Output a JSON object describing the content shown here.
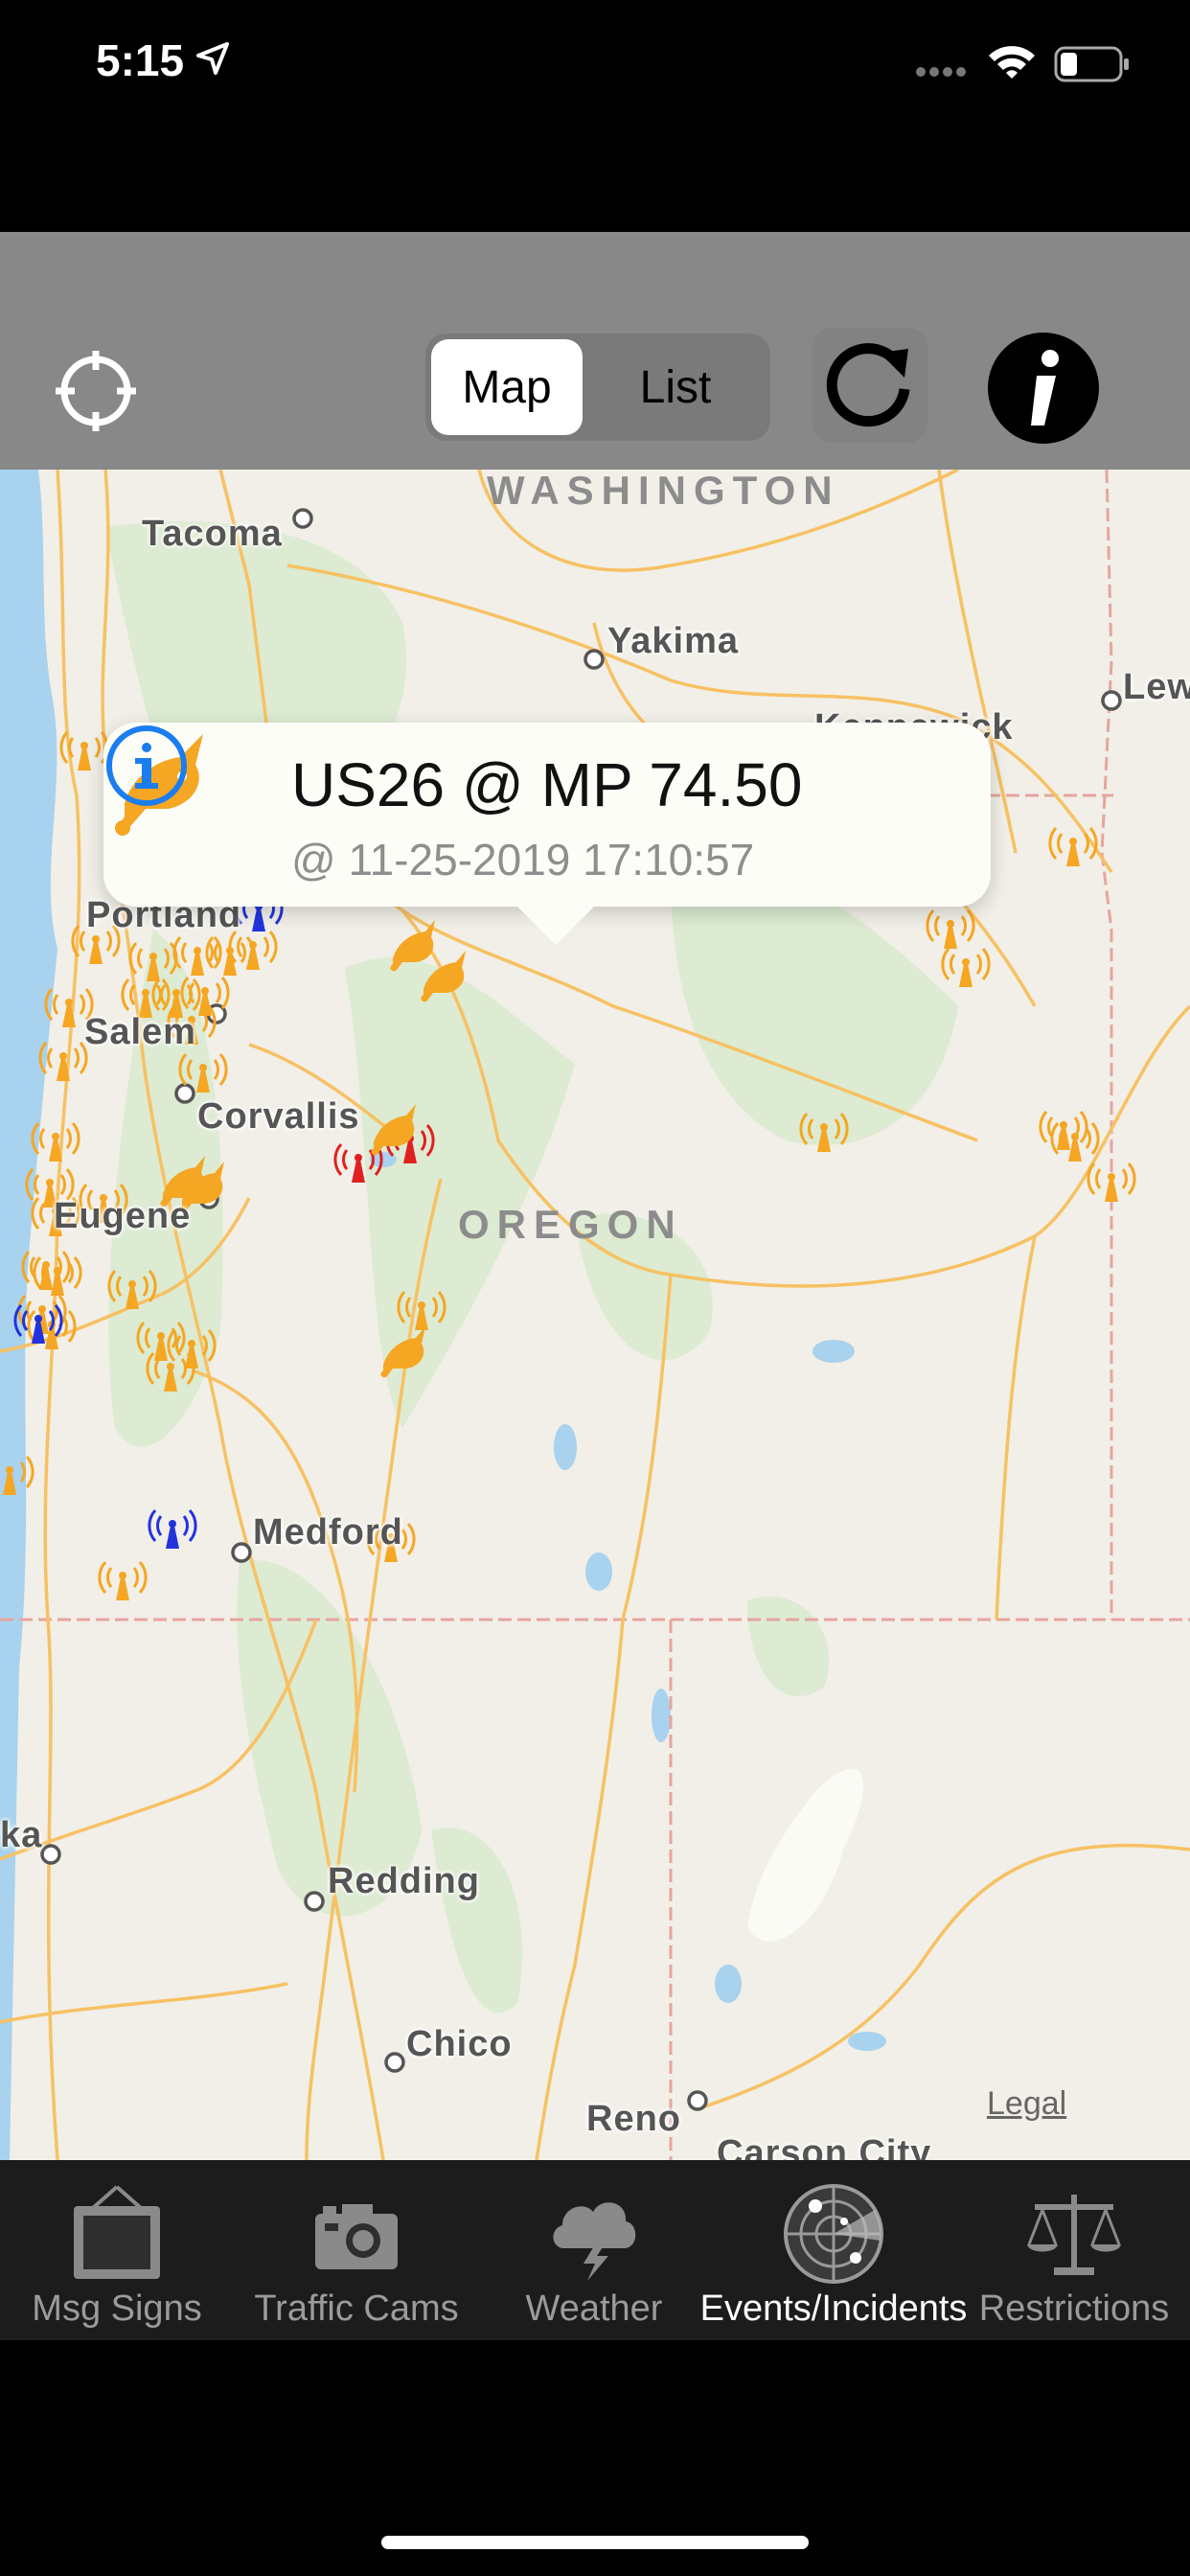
{
  "status_bar": {
    "time": "5:15"
  },
  "toolbar": {
    "segments": [
      {
        "label": "Map",
        "selected": true
      },
      {
        "label": "List",
        "selected": false
      }
    ],
    "icons": {
      "locate": "crosshair-icon",
      "refresh": "refresh-icon",
      "info": "info-icon"
    }
  },
  "map": {
    "states": [
      "WASHINGTON",
      "OREGON"
    ],
    "cities": [
      "Tacoma",
      "Yakima",
      "Kennewick",
      "Lew",
      "Portland",
      "Salem",
      "Corvallis",
      "Eugene",
      "Medford",
      "Redding",
      "Chico",
      "Reno",
      "Carson City",
      "ka"
    ],
    "legal": "Legal"
  },
  "callout": {
    "title": "US26 @ MP 74.50",
    "subtitle": "@ 11-25-2019 17:10:57",
    "icon": "incident-icon",
    "accent": "#1a7df0"
  },
  "tabs": [
    {
      "label": "Msg Signs",
      "icon": "message-sign-icon",
      "active": false
    },
    {
      "label": "Traffic Cams",
      "icon": "camera-icon",
      "active": false
    },
    {
      "label": "Weather",
      "icon": "weather-cloud-icon",
      "active": false
    },
    {
      "label": "Events/Incidents",
      "icon": "radar-icon",
      "active": true
    },
    {
      "label": "Restrictions",
      "icon": "scales-icon",
      "active": false
    }
  ],
  "colors": {
    "incident": "#f5a623",
    "alert": "#e02020",
    "info_marker": "#2233dd"
  }
}
